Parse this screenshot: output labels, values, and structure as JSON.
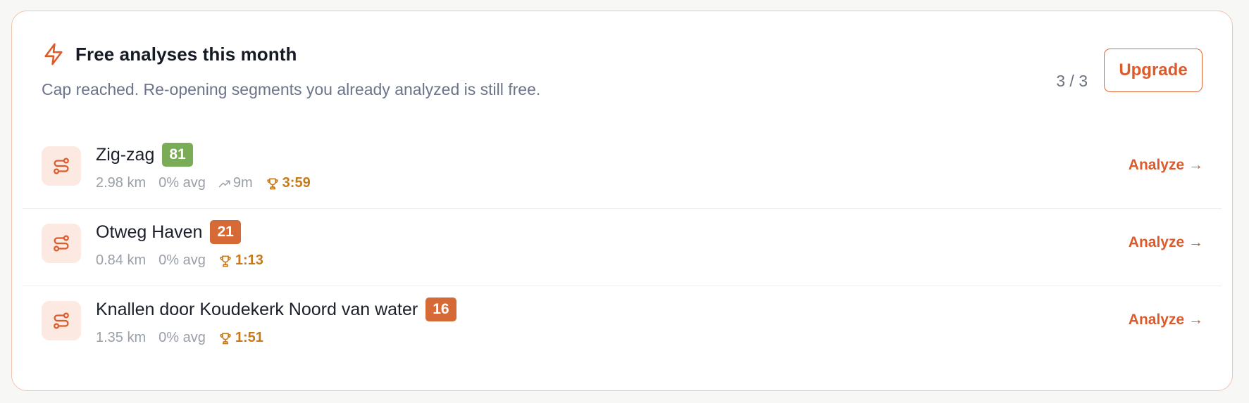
{
  "header": {
    "title": "Free analyses this month",
    "subtitle": "Cap reached. Re-opening segments you already analyzed is still free.",
    "usage": "3 / 3",
    "upgrade_label": "Upgrade"
  },
  "colors": {
    "accent": "#dd5a2b",
    "score_high": "#7aab56",
    "score_low": "#d56a36",
    "pr": "#c67a1a"
  },
  "segments": [
    {
      "name": "Zig-zag",
      "score": "81",
      "score_level": "high",
      "distance": "2.98 km",
      "grade": "0% avg",
      "elevation": "9m",
      "pr_time": "3:59",
      "action": "Analyze →"
    },
    {
      "name": "Otweg Haven",
      "score": "21",
      "score_level": "low",
      "distance": "0.84 km",
      "grade": "0% avg",
      "elevation": null,
      "pr_time": "1:13",
      "action": "Analyze →"
    },
    {
      "name": "Knallen door Koudekerk Noord van water",
      "score": "16",
      "score_level": "low",
      "distance": "1.35 km",
      "grade": "0% avg",
      "elevation": null,
      "pr_time": "1:51",
      "action": "Analyze →"
    }
  ],
  "icons": {
    "header": "lightning-bolt-icon",
    "segment": "route-icon",
    "elevation": "trending-up-icon",
    "pr": "trophy-icon"
  }
}
